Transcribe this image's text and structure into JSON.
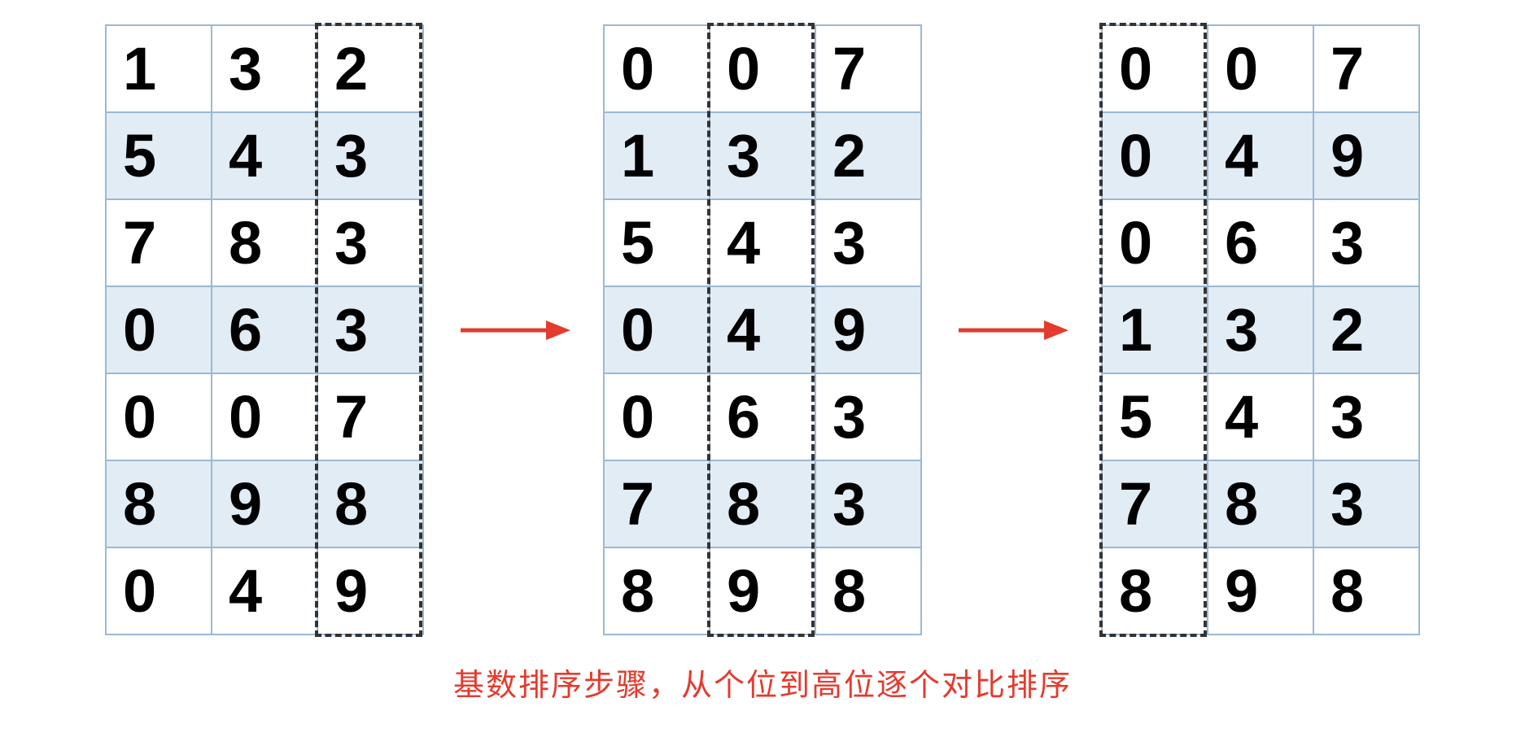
{
  "tables": [
    {
      "highlightCol": 2,
      "rows": [
        [
          "1",
          "3",
          "2"
        ],
        [
          "5",
          "4",
          "3"
        ],
        [
          "7",
          "8",
          "3"
        ],
        [
          "0",
          "6",
          "3"
        ],
        [
          "0",
          "0",
          "7"
        ],
        [
          "8",
          "9",
          "8"
        ],
        [
          "0",
          "4",
          "9"
        ]
      ]
    },
    {
      "highlightCol": 1,
      "rows": [
        [
          "0",
          "0",
          "7"
        ],
        [
          "1",
          "3",
          "2"
        ],
        [
          "5",
          "4",
          "3"
        ],
        [
          "0",
          "4",
          "9"
        ],
        [
          "0",
          "6",
          "3"
        ],
        [
          "7",
          "8",
          "3"
        ],
        [
          "8",
          "9",
          "8"
        ]
      ]
    },
    {
      "highlightCol": 0,
      "rows": [
        [
          "0",
          "0",
          "7"
        ],
        [
          "0",
          "4",
          "9"
        ],
        [
          "0",
          "6",
          "3"
        ],
        [
          "1",
          "3",
          "2"
        ],
        [
          "5",
          "4",
          "3"
        ],
        [
          "7",
          "8",
          "3"
        ],
        [
          "8",
          "9",
          "8"
        ]
      ]
    }
  ],
  "caption": "基数排序步骤，从个位到高位逐个对比排序",
  "arrowColor": "#e33b2e"
}
